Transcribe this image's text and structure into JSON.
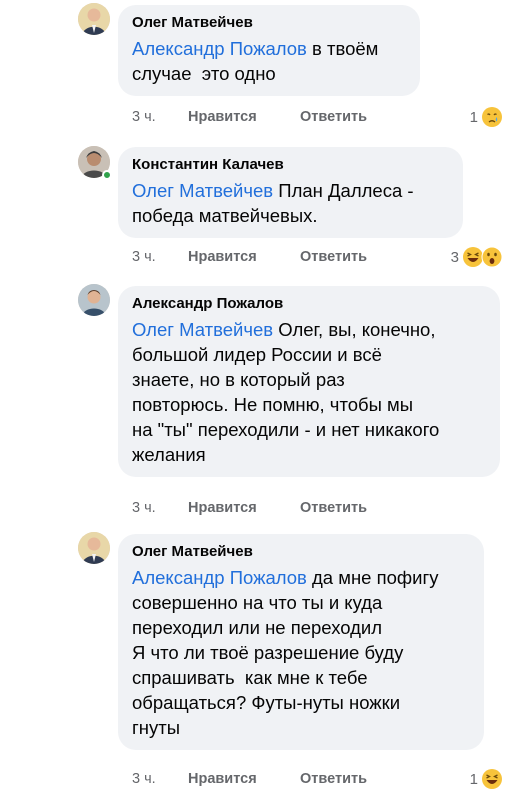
{
  "actions": {
    "time": "3 ч.",
    "like": "Нравится",
    "reply": "Ответить"
  },
  "comments": [
    {
      "author": "Олег Матвейчев",
      "mention": "Александр Пожалов",
      "text_line1": " в твоём",
      "text_rest": "случае  это одно",
      "reaction_count": "1",
      "reaction_icons": [
        "crying-face-icon"
      ]
    },
    {
      "author": "Константин Калачев",
      "mention": "Олег Матвейчев",
      "text_line1": " План Даллеса -",
      "text_rest": "победа матвейчевых.",
      "reaction_count": "3",
      "reaction_icons": [
        "laughing-face-icon",
        "astonished-face-icon"
      ]
    },
    {
      "author": "Александр Пожалов",
      "mention": "Олег Матвейчев",
      "text_line1": " Олег, вы, конечно,",
      "text_rest": "большой лидер России и всё\nзнаете, но в который раз\nповторюсь. Не помню, чтобы мы\nна \"ты\" переходили - и нет никакого\nжелания"
    },
    {
      "author": "Олег Матвейчев",
      "mention": "Александр Пожалов",
      "text_line1": " да мне пофигу",
      "text_rest": "совершенно на что ты и куда\nпереходил или не переходил\nЯ что ли твоё разрешение буду\nспрашивать  как мне к тебе\nобращаться? Футы-нуты ножки\nгнуты",
      "reaction_count": "1",
      "reaction_icons": [
        "laughing-face-icon"
      ]
    }
  ]
}
